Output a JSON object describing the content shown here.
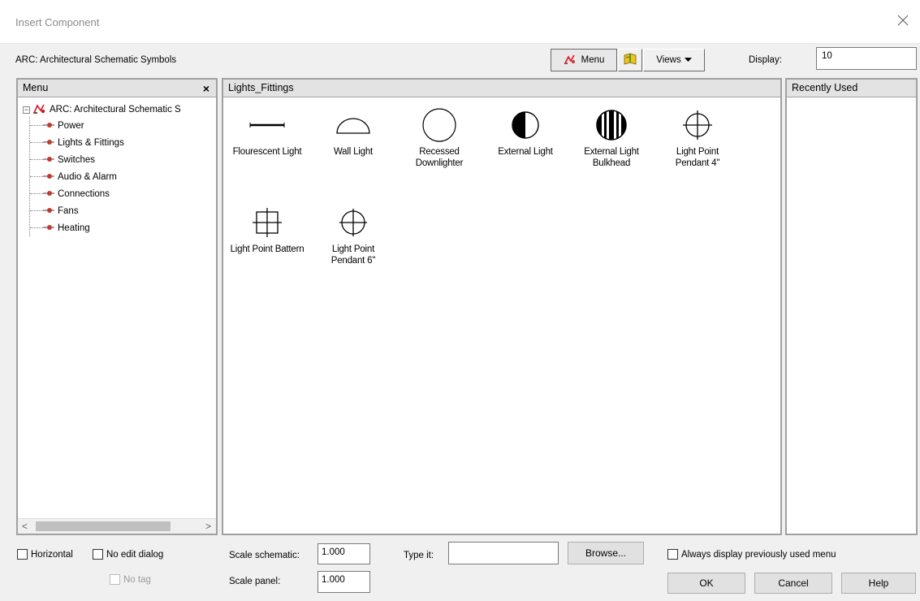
{
  "window": {
    "title": "Insert Component"
  },
  "toolbar": {
    "library_name": "ARC: Architectural Schematic Symbols",
    "menu_label": "Menu",
    "views_label": "Views",
    "display_label": "Display:",
    "display_value": "10"
  },
  "menu_panel": {
    "header": "Menu",
    "close_glyph": "×",
    "root_label": "ARC: Architectural Schematic S",
    "items": [
      "Power",
      "Lights & Fittings",
      "Switches",
      "Audio & Alarm",
      "Connections",
      "Fans",
      "Heating"
    ],
    "scroll_left": "<",
    "scroll_right": ">"
  },
  "center_panel": {
    "header": "Lights_Fittings",
    "symbols": [
      {
        "label": "Flourescent Light",
        "icon": "fluorescent-line-icon"
      },
      {
        "label": "Wall Light",
        "icon": "half-circle-icon"
      },
      {
        "label": "Recessed Downlighter",
        "icon": "circle-icon"
      },
      {
        "label": "External Light",
        "icon": "half-filled-circle-icon"
      },
      {
        "label": "External Light Bulkhead",
        "icon": "striped-circle-icon"
      },
      {
        "label": "Light Point Pendant 4\"",
        "icon": "crosshair-circle-icon"
      },
      {
        "label": "Light Point Battern",
        "icon": "square-cross-icon"
      },
      {
        "label": "Light Point Pendant 6\"",
        "icon": "circle-cross-icon"
      }
    ]
  },
  "recent_panel": {
    "header": "Recently Used"
  },
  "footer": {
    "horizontal_label": "Horizontal",
    "no_edit_label": "No edit dialog",
    "no_tag_label": "No tag",
    "scale_schematic_label": "Scale schematic:",
    "scale_schematic_value": "1.000",
    "scale_panel_label": "Scale panel:",
    "scale_panel_value": "1.000",
    "type_it_label": "Type it:",
    "type_it_value": "",
    "browse_label": "Browse...",
    "always_display_label": "Always display previously used menu",
    "ok_label": "OK",
    "cancel_label": "Cancel",
    "help_label": "Help"
  }
}
